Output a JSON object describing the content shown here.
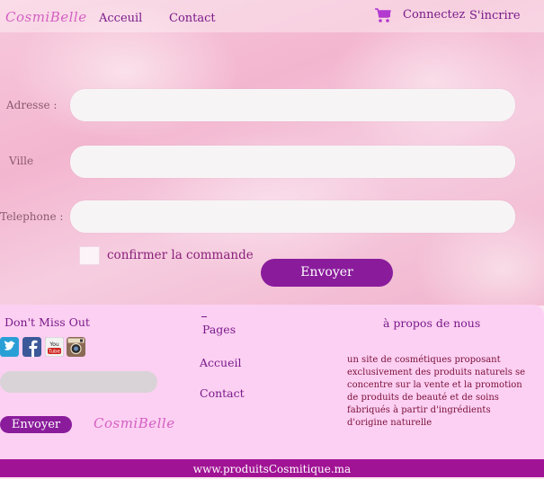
{
  "header": {
    "logo": "CosmiBelle",
    "nav": [
      "Acceuil",
      "Contact"
    ],
    "connect": "Connectez",
    "signup": "S'incrire",
    "cart_icon": "cart-icon"
  },
  "form": {
    "address_label": "Adresse :",
    "city_label": "Ville",
    "phone_label": "Telephone :",
    "address_value": "",
    "city_value": "",
    "phone_value": "",
    "confirm_label": "confirmer la commande",
    "submit": "Envoyer"
  },
  "footer": {
    "newsletter_title": "Don't Miss Out",
    "social": [
      "twitter-icon",
      "facebook-icon",
      "youtube-icon",
      "instagram-icon"
    ],
    "newsletter_button": "Envoyer",
    "logo": "CosmiBelle",
    "pages_title": "Pages",
    "pages": [
      "Accueil",
      "Contact"
    ],
    "about_title": "à propos de nous",
    "about_text": "un site de cosmétiques proposant exclusivement des produits naturels se concentre sur la vente et la promotion de produits de beauté et de soins fabriqués à partir d'ingrédients d'origine naturelle"
  },
  "bottom_bar": "www.produitsCosmitique.ma",
  "colors": {
    "accent": "#8a1c9c",
    "footer": "#fcd0f2",
    "bottom": "#a11395"
  }
}
